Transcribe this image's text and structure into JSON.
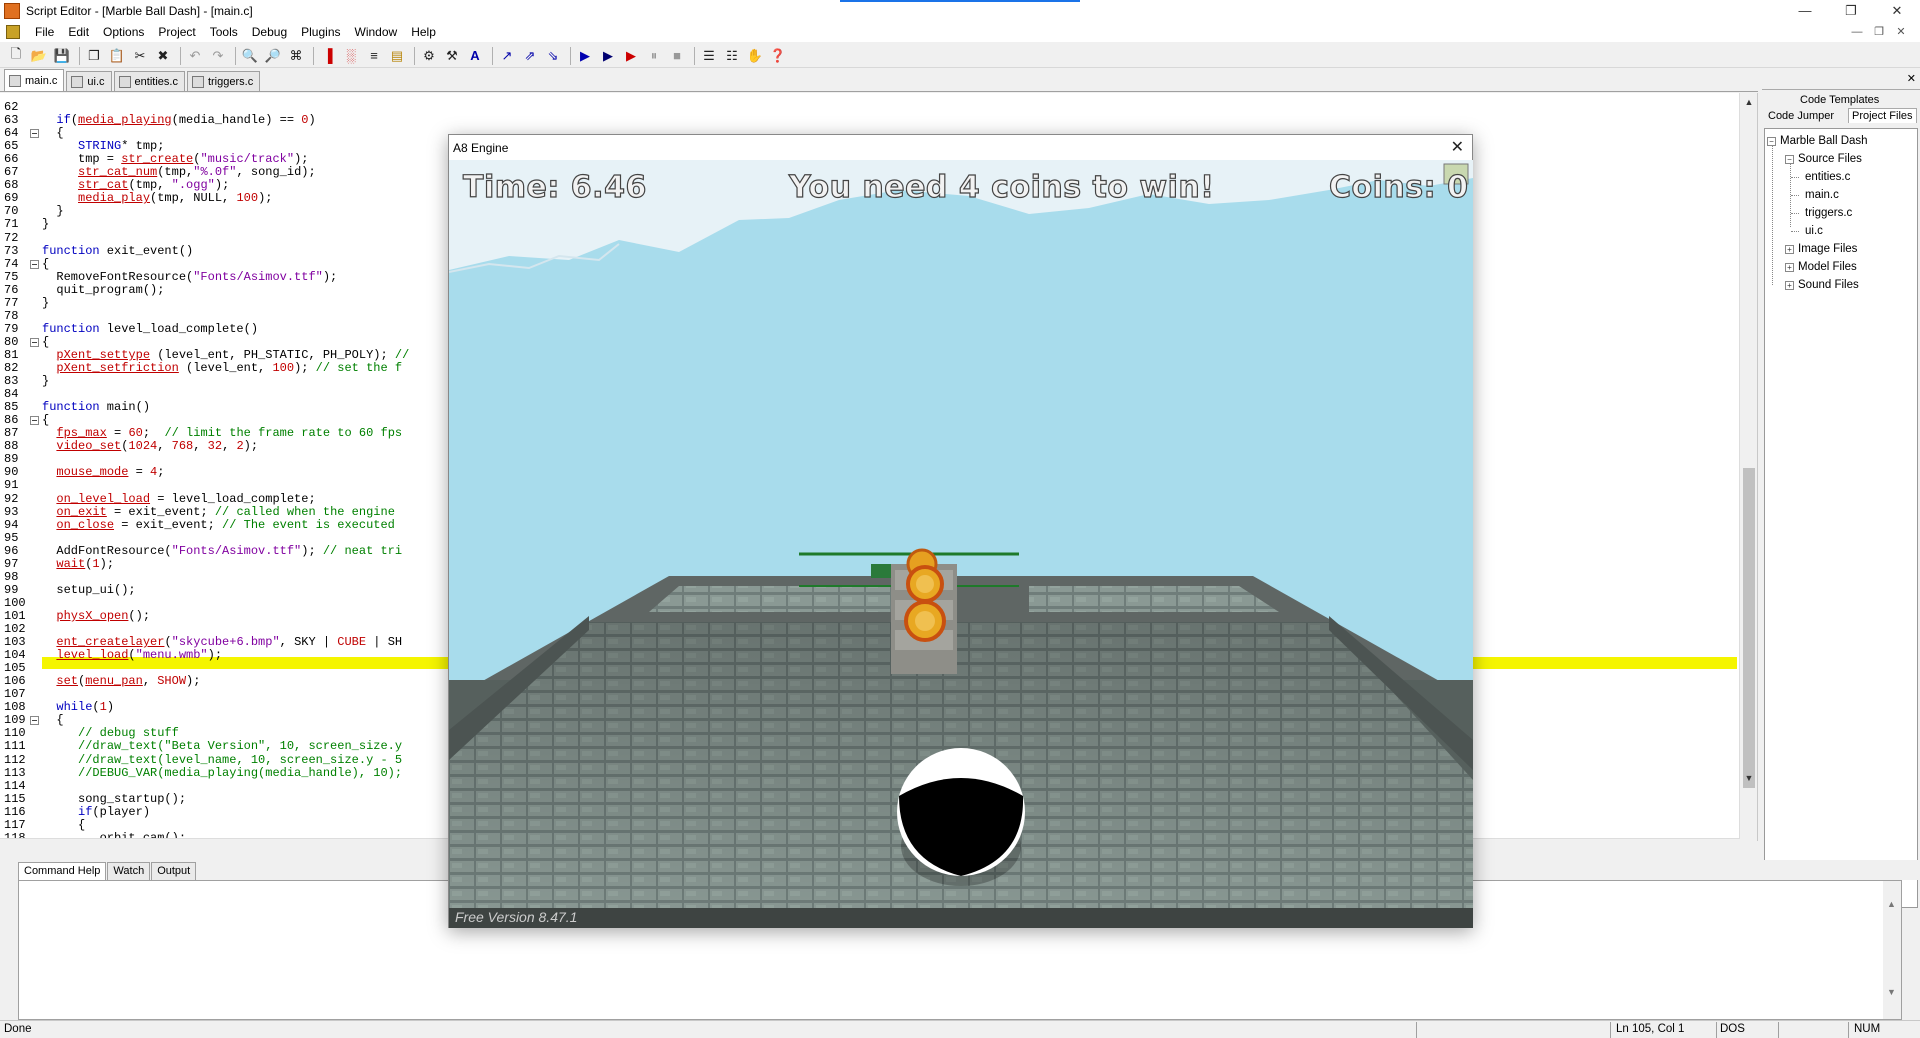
{
  "window": {
    "title": "Script Editor - [Marble Ball Dash] - [main.c]"
  },
  "menu": [
    "File",
    "Edit",
    "Options",
    "Project",
    "Tools",
    "Debug",
    "Plugins",
    "Window",
    "Help"
  ],
  "file_tabs": [
    "main.c",
    "ui.c",
    "entities.c",
    "triggers.c"
  ],
  "right_panel": {
    "tabs": [
      "Code Templates",
      "Code Jumper",
      "Project Files"
    ],
    "tree": {
      "root": "Marble Ball Dash",
      "source_files": "Source Files",
      "files": [
        "entities.c",
        "main.c",
        "triggers.c",
        "ui.c"
      ],
      "other": [
        "Image Files",
        "Model Files",
        "Sound Files"
      ]
    }
  },
  "bottom_tabs": [
    "Command Help",
    "Watch",
    "Output"
  ],
  "status": {
    "left": "Done",
    "position": "Ln 105, Col 1",
    "format": "DOS",
    "numlock": "NUM"
  },
  "game": {
    "window_title": "A8 Engine",
    "hud_time": "Time: 6.46",
    "hud_message": "You need 4 coins to win!",
    "hud_coins": "Coins: 0",
    "free_version": "Free Version 8.47.1"
  }
}
